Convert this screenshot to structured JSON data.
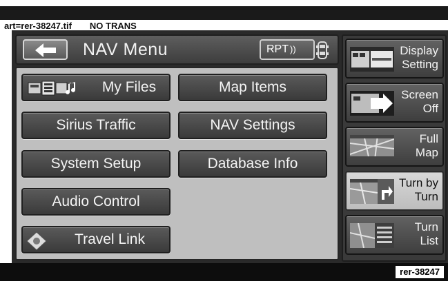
{
  "caption": {
    "art_id": "art=rer-38247.tif",
    "trans": "NO TRANS"
  },
  "header": {
    "title": "NAV Menu",
    "rpt_label": "RPT",
    "rpt_waves": "))"
  },
  "menu": {
    "left": [
      "My Files",
      "Sirius Traffic",
      "System Setup",
      "Audio Control",
      "Travel Link"
    ],
    "right": [
      "Map Items",
      "NAV Settings",
      "Database Info"
    ]
  },
  "side": {
    "display_setting": [
      "Display",
      "Setting"
    ],
    "screen_off": [
      "Screen",
      "Off"
    ],
    "full_map": [
      "Full",
      "Map"
    ],
    "turn_by_turn": [
      "Turn by",
      "Turn"
    ],
    "turn_list": [
      "Turn",
      "List"
    ]
  },
  "ref_label": "rer-38247",
  "icons": [
    "back-arrow-icon",
    "car-icon",
    "files-icon",
    "travel-link-icon"
  ]
}
